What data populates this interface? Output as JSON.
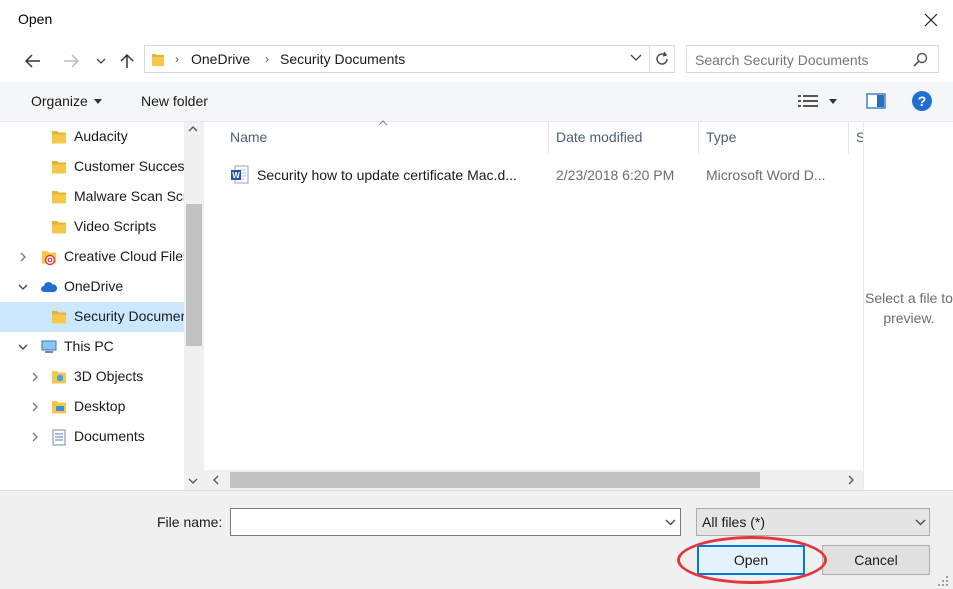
{
  "window": {
    "title": "Open"
  },
  "address_bar": {
    "crumbs": [
      "OneDrive",
      "Security Documents"
    ]
  },
  "search": {
    "placeholder": "Search Security Documents"
  },
  "toolbar": {
    "organize_label": "Organize",
    "new_folder_label": "New folder"
  },
  "sidebar": {
    "items": [
      {
        "label": "Audacity",
        "icon": "folder-icon",
        "indent": 2,
        "expander": "none",
        "selected": false
      },
      {
        "label": "Customer Success",
        "icon": "folder-icon",
        "indent": 2,
        "expander": "none",
        "selected": false
      },
      {
        "label": "Malware Scan Scripts",
        "icon": "folder-icon",
        "indent": 2,
        "expander": "none",
        "selected": false
      },
      {
        "label": "Video Scripts",
        "icon": "folder-icon",
        "indent": 2,
        "expander": "none",
        "selected": false
      },
      {
        "label": "Creative Cloud Files",
        "icon": "creative-cloud-icon",
        "indent": 1,
        "expander": "collapsed",
        "selected": false
      },
      {
        "label": "OneDrive",
        "icon": "onedrive-cloud-icon",
        "indent": 1,
        "expander": "expanded",
        "selected": false
      },
      {
        "label": "Security Documents",
        "icon": "folder-icon",
        "indent": 2,
        "expander": "none",
        "selected": true
      },
      {
        "label": "This PC",
        "icon": "computer-icon",
        "indent": 1,
        "expander": "expanded",
        "selected": false
      },
      {
        "label": "3D Objects",
        "icon": "3d-objects-folder-icon",
        "indent": 2,
        "expander": "collapsed",
        "selected": false
      },
      {
        "label": "Desktop",
        "icon": "desktop-folder-icon",
        "indent": 2,
        "expander": "collapsed",
        "selected": false
      },
      {
        "label": "Documents",
        "icon": "documents-folder-icon",
        "indent": 2,
        "expander": "collapsed",
        "selected": false
      }
    ]
  },
  "file_list": {
    "columns": [
      "Name",
      "Date modified",
      "Type",
      "S"
    ],
    "rows": [
      {
        "name": "Security how to update certificate Mac.d...",
        "date": "2/23/2018 6:20 PM",
        "type": "Microsoft Word D...",
        "icon": "word-document-icon"
      }
    ]
  },
  "preview": {
    "message": "Select a file to preview."
  },
  "bottom": {
    "file_name_label": "File name:",
    "file_name_value": "",
    "file_type_value": "All files (*)",
    "open_label": "Open",
    "cancel_label": "Cancel"
  },
  "colors": {
    "accent": "#0078d7",
    "selection": "#cce8ff",
    "highlight_ring": "#e0383b",
    "folder": "#f5c84c"
  }
}
